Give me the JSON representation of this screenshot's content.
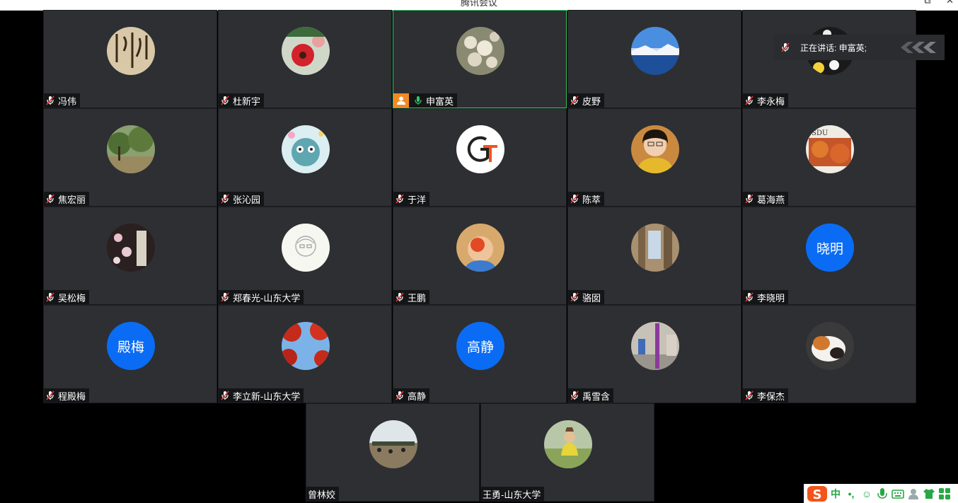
{
  "window": {
    "title": "腾讯会议",
    "controls": [
      "⧉",
      "✕"
    ]
  },
  "speaking": {
    "label": "正在讲话: 申富英;"
  },
  "colors": {
    "tile_bg": "#2d2f33",
    "active_border": "#37c465",
    "text_avatar": "#0a6cf5",
    "badge": "#f08a24"
  },
  "participants": [
    {
      "name": "冯伟",
      "avatar_kind": "calligraphy",
      "mic": "muted"
    },
    {
      "name": "杜新宇",
      "avatar_kind": "flower",
      "mic": "muted"
    },
    {
      "name": "申富英",
      "avatar_kind": "blossom",
      "mic": "active",
      "badge": "user-icon"
    },
    {
      "name": "皮野",
      "avatar_kind": "lake",
      "mic": "muted"
    },
    {
      "name": "李永梅",
      "avatar_kind": "flowers-dark",
      "mic": "muted"
    },
    {
      "name": "焦宏丽",
      "avatar_kind": "trees",
      "mic": "muted"
    },
    {
      "name": "张沁园",
      "avatar_kind": "cartoon",
      "mic": "muted"
    },
    {
      "name": "于洋",
      "avatar_kind": "logo-gt",
      "mic": "muted"
    },
    {
      "name": "陈萃",
      "avatar_kind": "portrait",
      "mic": "muted"
    },
    {
      "name": "葛海燕",
      "avatar_kind": "sdu-building",
      "mic": "muted"
    },
    {
      "name": "吴松梅",
      "avatar_kind": "plum-blossom",
      "mic": "muted"
    },
    {
      "name": "郑春光-山东大学",
      "avatar_kind": "sketch",
      "mic": "muted"
    },
    {
      "name": "王鹏",
      "avatar_kind": "child",
      "mic": "muted"
    },
    {
      "name": "骆囡",
      "avatar_kind": "ruins",
      "mic": "muted"
    },
    {
      "name": "李晓明",
      "avatar_text": "晓明",
      "mic": "muted"
    },
    {
      "name": "程殿梅",
      "avatar_text": "殿梅",
      "mic": "muted"
    },
    {
      "name": "李立新-山东大学",
      "avatar_kind": "red-leaves",
      "mic": "muted"
    },
    {
      "name": "高静",
      "avatar_text": "高静",
      "mic": "muted"
    },
    {
      "name": "禹雪含",
      "avatar_kind": "street",
      "mic": "muted"
    },
    {
      "name": "李保杰",
      "avatar_kind": "cat",
      "mic": "muted"
    },
    {
      "name": "曾林姣",
      "avatar_kind": "landscape",
      "mic": "none"
    },
    {
      "name": "王勇-山东大学",
      "avatar_kind": "outdoor-person",
      "mic": "none"
    }
  ],
  "ime": {
    "label": "中",
    "items": [
      "中",
      "•,",
      "☺",
      "mic",
      "keyboard",
      "user",
      "shirt",
      "grid"
    ]
  }
}
